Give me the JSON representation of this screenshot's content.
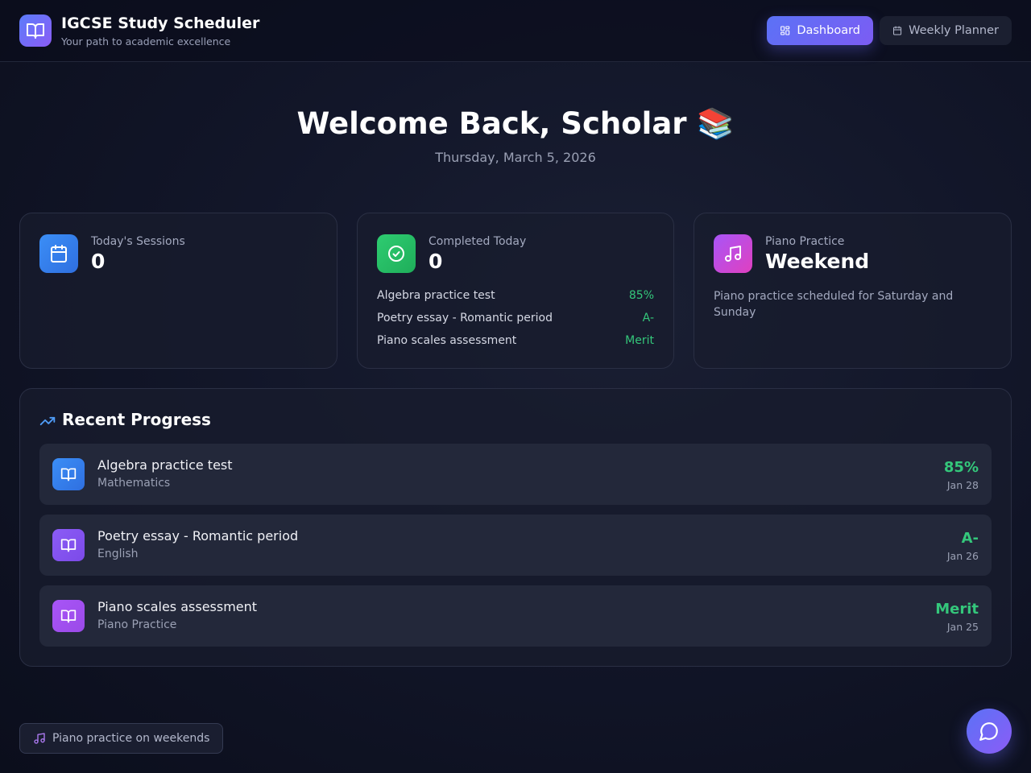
{
  "app": {
    "title": "IGCSE Study Scheduler",
    "subtitle": "Your path to academic excellence",
    "logo_icon": "book-open-icon"
  },
  "nav": {
    "dashboard_label": "Dashboard",
    "planner_label": "Weekly Planner",
    "active": "Dashboard"
  },
  "welcome": {
    "heading": "Welcome Back, Scholar 📚",
    "date": "Thursday, March 5, 2026"
  },
  "cards": {
    "sessions": {
      "label": "Today's Sessions",
      "value": "0",
      "icon": "calendar-icon"
    },
    "completed": {
      "label": "Completed Today",
      "value": "0",
      "icon": "check-circle-icon",
      "items": [
        {
          "title": "Algebra practice test",
          "score": "85%"
        },
        {
          "title": "Poetry essay - Romantic period",
          "score": "A-"
        },
        {
          "title": "Piano scales assessment",
          "score": "Merit"
        }
      ]
    },
    "piano": {
      "label": "Piano Practice",
      "value": "Weekend",
      "note": "Piano practice scheduled for Saturday and Sunday",
      "icon": "music-icon"
    }
  },
  "progress": {
    "title": "Recent Progress",
    "items": [
      {
        "title": "Algebra practice test",
        "subject": "Mathematics",
        "score": "85%",
        "date": "Jan 28",
        "color": "#3b82f6"
      },
      {
        "title": "Poetry essay - Romantic period",
        "subject": "English",
        "score": "A-",
        "date": "Jan 26",
        "color": "#8b5cf6"
      },
      {
        "title": "Piano scales assessment",
        "subject": "Piano Practice",
        "score": "Merit",
        "date": "Jan 25",
        "color": "#a855f7"
      }
    ]
  },
  "footer": {
    "pill_label": "Piano practice on weekends"
  },
  "colors": {
    "accent": "#6366f1",
    "success": "#34c77b",
    "sessions_icon": "#3b82f6",
    "completed_icon": "#22c55e",
    "piano_icon": "#c040e0"
  }
}
